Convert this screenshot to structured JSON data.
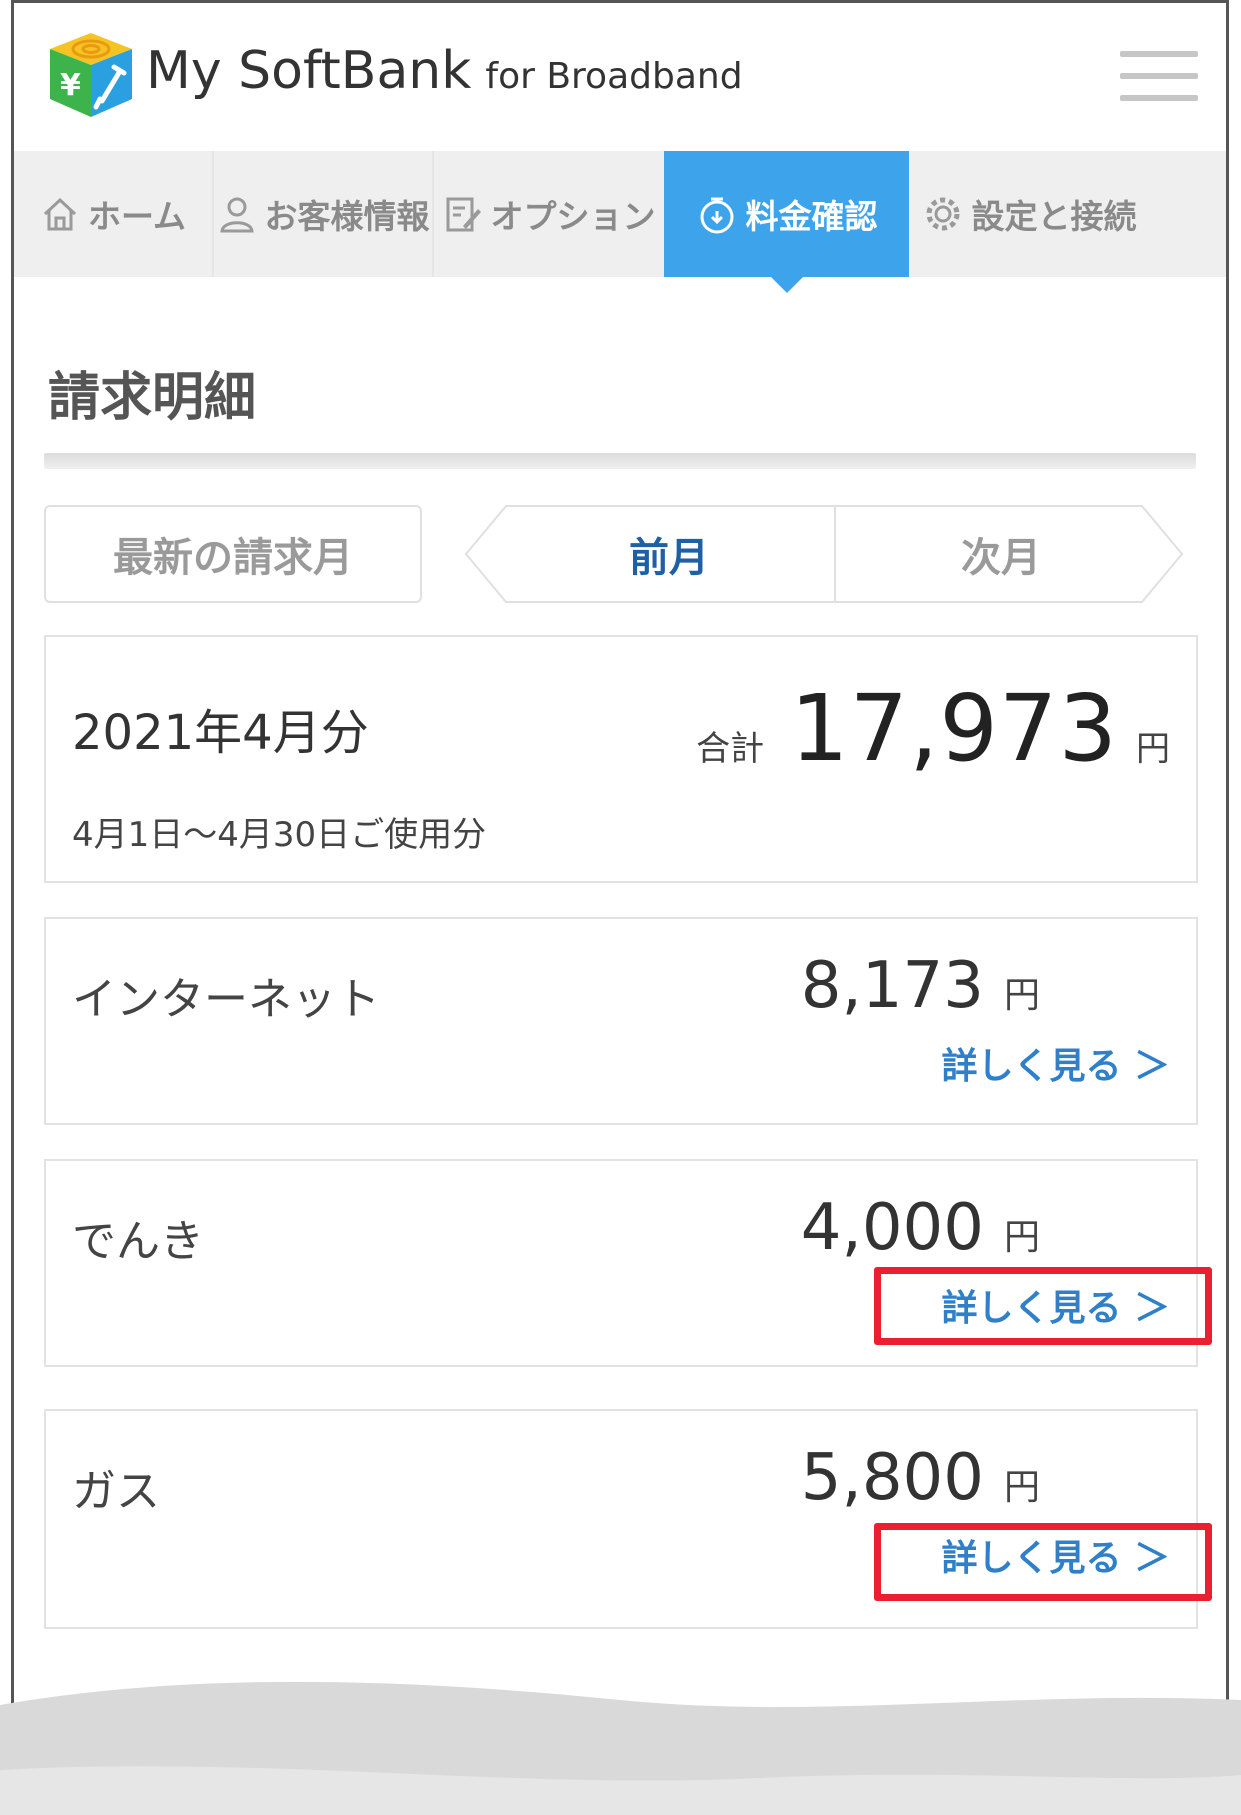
{
  "header": {
    "logo_text": "My SoftBank",
    "logo_sub": "for Broadband"
  },
  "nav": {
    "items": [
      {
        "label": "ホーム",
        "icon": "home-icon"
      },
      {
        "label": "お客様情報",
        "icon": "user-icon"
      },
      {
        "label": "オプション",
        "icon": "edit-icon"
      },
      {
        "label": "料金確認",
        "icon": "fee-icon",
        "active": true
      },
      {
        "label": "設定と接続",
        "icon": "gear-icon"
      }
    ]
  },
  "page": {
    "title": "請求明細"
  },
  "month_tabs": {
    "latest": "最新の請求月",
    "prev": "前月",
    "next": "次月"
  },
  "summary": {
    "period": "2021年4月分",
    "usage": "4月1日～4月30日ご使用分",
    "total_label": "合計",
    "total_amount": "17,973",
    "currency": "円"
  },
  "items": [
    {
      "name": "インターネット",
      "amount": "8,173",
      "currency": "円",
      "detail": "詳しく見る ＞"
    },
    {
      "name": "でんき",
      "amount": "4,000",
      "currency": "円",
      "detail": "詳しく見る ＞"
    },
    {
      "name": "ガス",
      "amount": "5,800",
      "currency": "円",
      "detail": "詳しく見る ＞"
    }
  ],
  "colors": {
    "accent": "#3da3ea",
    "link": "#2f7fc9",
    "highlight": "#e8202f"
  }
}
